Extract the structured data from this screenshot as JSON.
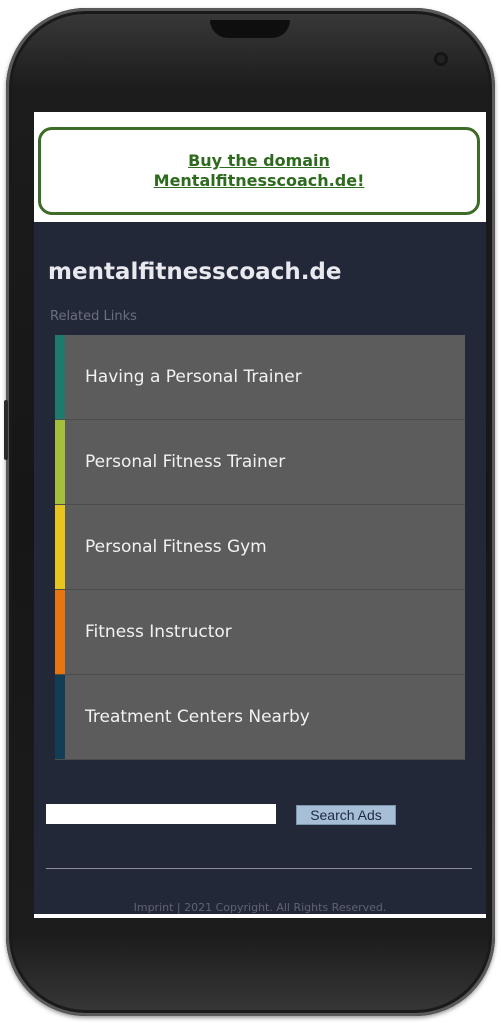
{
  "banner": {
    "line1": "Buy the domain",
    "line2": "Mentalfitnesscoach.de!"
  },
  "site": {
    "title": "mentalfitnesscoach.de"
  },
  "related": {
    "label": "Related Links",
    "items": [
      {
        "label": "Having a Personal Trainer",
        "color": "#1f7a6c"
      },
      {
        "label": "Personal Fitness Trainer",
        "color": "#a3bf3b"
      },
      {
        "label": "Personal Fitness Gym",
        "color": "#e8c51e"
      },
      {
        "label": "Fitness Instructor",
        "color": "#e8750f"
      },
      {
        "label": "Treatment Centers Nearby",
        "color": "#123d55"
      }
    ]
  },
  "search": {
    "input_value": "",
    "button_label": "Search Ads"
  },
  "footer": {
    "text": "Imprint | 2021 Copyright. All Rights Reserved."
  },
  "colors": {
    "page_bg": "#232838",
    "tile_bg": "#5c5c5c",
    "banner_green": "#2e6b1f"
  }
}
